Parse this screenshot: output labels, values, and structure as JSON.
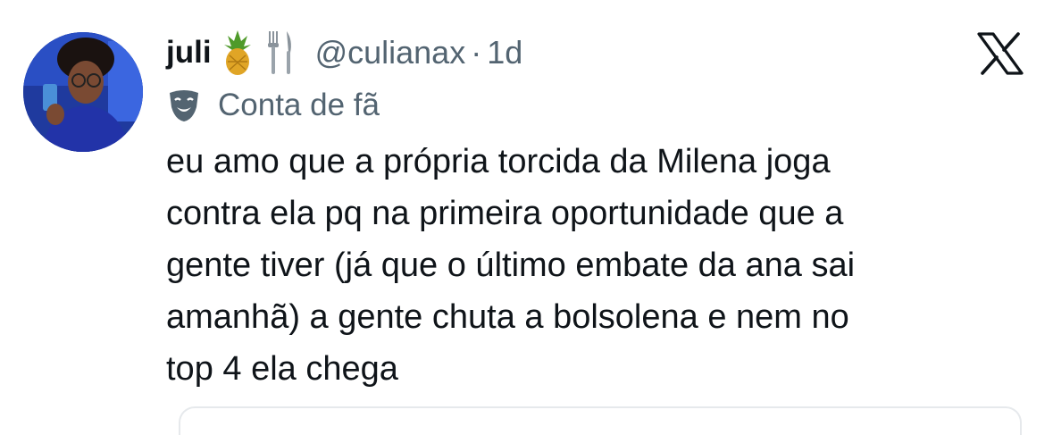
{
  "tweet": {
    "author": {
      "name": "juli",
      "handle": "@culianax",
      "emojis": [
        "pineapple-icon",
        "fork-knife-icon"
      ]
    },
    "separator": "·",
    "time": "1d",
    "label": {
      "icon": "theater-masks-icon",
      "text": "Conta de fã"
    },
    "text": "eu amo que a própria torcida da Milena joga\ncontra ela pq na primeira oportunidade que a\ngente tiver (já que o último embate da ana sai\namanhã) a gente chuta a bolsolena e nem no\ntop 4 ela chega",
    "brand_icon": "x-logo-icon"
  },
  "colors": {
    "text_primary": "#0f1419",
    "text_secondary": "#536471",
    "avatar_bg": "#1f3a9e"
  }
}
